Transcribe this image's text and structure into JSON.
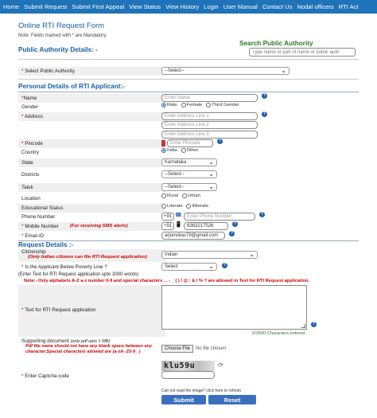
{
  "nav": [
    "Home",
    "Submit Request",
    "Submit First Appeal",
    "View Status",
    "View History",
    "Login",
    "User Manual",
    "Contact Us",
    "Nodal officers",
    "RTI Act"
  ],
  "form": {
    "title": "Online RTI Request Form",
    "note": "Note: Fields marked with * are Mandatory.",
    "search_title": "Search Public Authority",
    "search_placeholder": "Type name or part of name of public auth",
    "pad_section": "Public Authority Details: -",
    "select_pa_label": "Select Public Authority",
    "select_pa_value": "--Select--",
    "personal_section": "Personal Details of RTI Applicant:-",
    "name_label": "Name",
    "name_placeholder": "Enter Name",
    "gender_label": "Gender",
    "gender_options": [
      "Male",
      "Female",
      "Third Gender"
    ],
    "address_label": "Address",
    "address_lines": [
      "Enter Address Line 1",
      "Enter Address Line 2",
      "Enter Address Line 3"
    ],
    "pincode_label": "Pincode",
    "pincode_placeholder": "Enter Pincode",
    "country_label": "Country",
    "country_options": [
      "India",
      "Other"
    ],
    "state_label": "State",
    "state_value": "Karnataka",
    "districts_label": "Districts",
    "districts_value": "--Select--",
    "taluk_label": "Taluk",
    "taluk_value": "--Select--",
    "location_label": "Location",
    "location_options": [
      "Rural",
      "Urban"
    ],
    "edu_label": "Educational Status",
    "edu_options": [
      "Literate",
      "Illiterate"
    ],
    "phone_label": "Phone Number",
    "phone_prefix": "+91",
    "phone_placeholder": "Enter Phone Number",
    "mobile_label": "Mobile Number",
    "mobile_note": "(For receiving SMS alerts)",
    "mobile_prefix": "+91",
    "mobile_value": "6363217526",
    "email_label": "Email-ID",
    "email_value": "arjunvikas79@gmail.com",
    "request_section": "Request Details :-",
    "citizenship_label": "Citizenship",
    "citizenship_note": "(Only Indian citizens can file RTI Request application)",
    "citizenship_value": "Indian",
    "bpl_label": "Is the Applicant Below Poverty Line ?",
    "bpl_value": "Select",
    "text_hint": "(Enter Text for RTI Request application upto 3000 words)",
    "chars_note": "Note:- Only alphabets A-Z a-z number 0-9 and special characters , . - _ ( ) / @ : & \\ % ? are allowed in Text for RTI Request application.",
    "text_label": "Text for RTI Request application",
    "char_counter": "0/3000 Characters entered",
    "doc_label": "Supporting document",
    "doc_hint": "(only pdf upto 1 MB)",
    "doc_warning": "Pdf file name should not have any blank space between any character.Special characters allowed are (a-zA- Z0-9_ )",
    "choose_file": "Choose File",
    "no_file": "No file chosen",
    "captcha_text": "klu59u",
    "captcha_label": "Enter Captcha code",
    "refresh_text": "Can not read the image? click here to refresh",
    "submit": "Submit",
    "reset": "Reset"
  },
  "colors": {
    "nav_bg": "#1e73b9",
    "heading": "#1a5fa3",
    "search_heading": "#2c7a23",
    "warning": "#d00000",
    "button": "#3a6fc0"
  }
}
